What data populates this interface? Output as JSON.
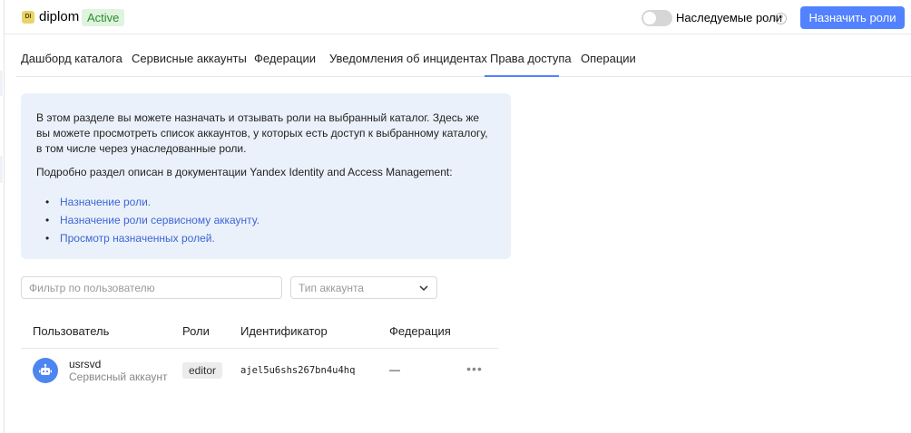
{
  "header": {
    "folder_icon_text": "DI",
    "folder_name": "diplom",
    "status": "Active",
    "inherited_roles_label": "Наследуемые роли",
    "help_glyph": "?",
    "assign_button": "Назначить роли"
  },
  "tabs": [
    {
      "label": "Дашборд каталога"
    },
    {
      "label": "Сервисные аккаунты"
    },
    {
      "label": "Федерации"
    },
    {
      "label": "Уведомления об инцидентах"
    },
    {
      "label": "Права доступа"
    },
    {
      "label": "Операции"
    }
  ],
  "info": {
    "paragraph1": "В этом разделе вы можете назначать и отзывать роли на выбранный каталог. Здесь же вы можете просмотреть список аккаунтов, у которых есть доступ к выбранному каталогу, в том числе через унаследованные роли.",
    "paragraph2": "Подробно раздел описан в документации Yandex Identity and Access Management:",
    "links": [
      {
        "label": "Назначение роли."
      },
      {
        "label": "Назначение роли сервисному аккаунту."
      },
      {
        "label": "Просмотр назначенных ролей."
      }
    ]
  },
  "filters": {
    "user_filter_placeholder": "Фильтр по пользователю",
    "account_type_placeholder": "Тип аккаунта"
  },
  "table": {
    "columns": [
      "Пользователь",
      "Роли",
      "Идентификатор",
      "Федерация"
    ],
    "rows": [
      {
        "name": "usrsvd",
        "type": "Сервисный аккаунт",
        "role": "editor",
        "id": "ajel5u6shs267bn4u4hq",
        "federation": "—",
        "more": "•••"
      }
    ]
  },
  "colors": {
    "accent": "#5282ff",
    "active_badge_bg": "#dff3df",
    "active_badge_text": "#2e8b2e",
    "info_bg": "#ebf1fa",
    "link": "#3b66d6"
  }
}
